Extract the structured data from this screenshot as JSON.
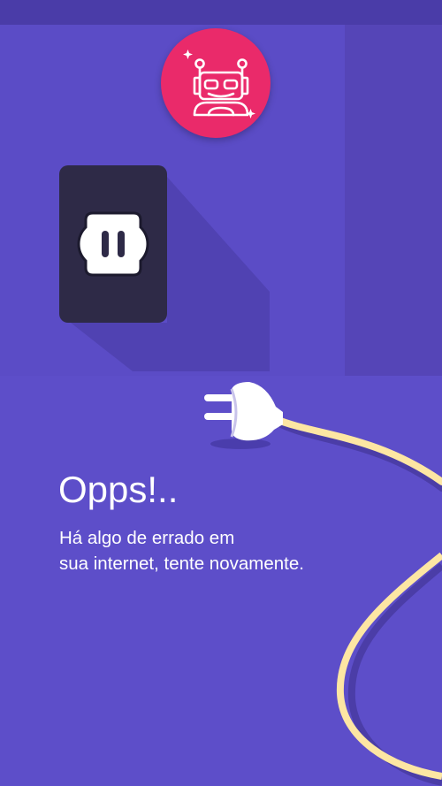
{
  "error": {
    "title": "Opps!..",
    "message_lines": [
      "Há algo de errado em",
      "sua internet, tente novamente."
    ]
  },
  "icons": {
    "logo": "robot-icon",
    "outlet": "power-outlet-icon",
    "plug": "unplugged-plug-icon"
  },
  "colors": {
    "background": "#5b4bc4",
    "status_bar": "#4a3ca8",
    "logo_badge": "#ea2a6a",
    "outlet": "#2e2a47",
    "cable": "#fde6a3",
    "text": "#ffffff"
  }
}
